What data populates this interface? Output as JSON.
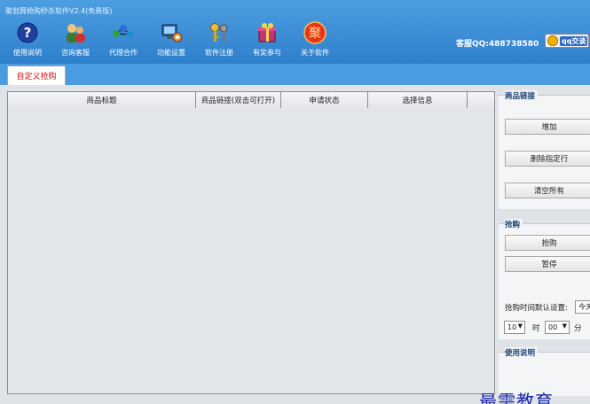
{
  "window": {
    "title": "聚划算抢购秒杀软件V2.4(免费版)"
  },
  "toolbar": {
    "items": [
      {
        "label": "使用说明",
        "icon": "help-icon"
      },
      {
        "label": "咨询客服",
        "icon": "customer-service-icon"
      },
      {
        "label": "代理合作",
        "icon": "partnership-icon"
      },
      {
        "label": "功能设置",
        "icon": "settings-icon"
      },
      {
        "label": "软件注册",
        "icon": "register-keys-icon"
      },
      {
        "label": "有奖参与",
        "icon": "prize-icon"
      },
      {
        "label": "关于软件",
        "icon": "about-icon"
      }
    ],
    "about_glyph": "聚"
  },
  "contact": {
    "text": "客服QQ:488738580",
    "qq_button": "qq交谈"
  },
  "tabs": [
    {
      "label": "自定义抢购",
      "active": true
    }
  ],
  "table": {
    "columns": [
      "商品标题",
      "商品链接(双击可打开)",
      "申请状态",
      "选择信息"
    ],
    "rows": []
  },
  "links_panel": {
    "title": "商品链接",
    "add": "增加",
    "delete_selected": "删除指定行",
    "clear_all": "清空所有"
  },
  "grab_panel": {
    "title": "抢购",
    "grab": "抢购",
    "pause": "暂停",
    "default_time_label": "抢购时间默认设置:",
    "day_value": "今天",
    "hour_value": "10",
    "hour_unit": "时",
    "minute_value": "00",
    "minute_unit": "分"
  },
  "usage_panel": {
    "title": "使用说明"
  },
  "watermark": "最需教育",
  "colors": {
    "titlebar": "#3a8ad6",
    "tab_active_text": "#d01010",
    "panel_title": "#1a3e72"
  }
}
